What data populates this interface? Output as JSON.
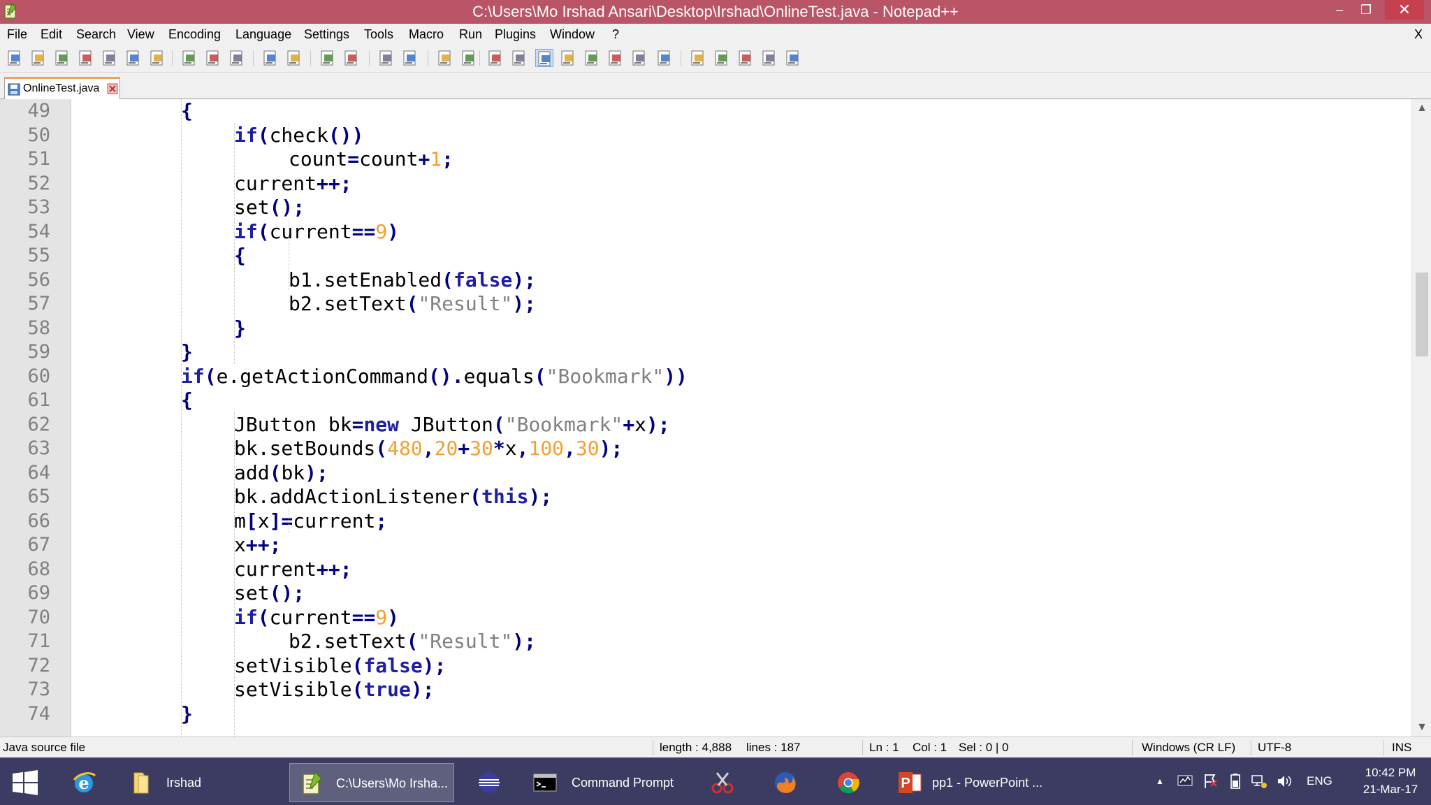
{
  "window": {
    "title": "C:\\Users\\Mo Irshad Ansari\\Desktop\\Irshad\\OnlineTest.java - Notepad++",
    "minimize": "–",
    "restore": "❐",
    "close": "✕"
  },
  "menu": {
    "items": [
      "File",
      "Edit",
      "Search",
      "View",
      "Encoding",
      "Language",
      "Settings",
      "Tools",
      "Macro",
      "Run",
      "Plugins",
      "Window",
      "?"
    ],
    "close": "X"
  },
  "toolbar": {
    "buttons": [
      "new-file-icon",
      "open-file-icon",
      "save-icon",
      "save-all-icon",
      "close-icon",
      "close-all-icon",
      "print-icon",
      "cut-icon",
      "copy-icon",
      "paste-icon",
      "undo-icon",
      "redo-icon",
      "find-icon",
      "replace-icon",
      "zoom-in-icon",
      "zoom-out-icon",
      "sync-vertical-icon",
      "sync-horizontal-icon",
      "word-wrap-icon",
      "show-all-chars-icon",
      "indent-guide-icon",
      "user-lang-icon",
      "doc-map-icon",
      "function-list-icon",
      "folder-workspace-icon",
      "monitoring-icon",
      "record-macro-icon",
      "stop-macro-icon",
      "play-macro-icon",
      "play-multiple-icon",
      "save-macro-icon"
    ]
  },
  "tab": {
    "label": "OnlineTest.java"
  },
  "editor": {
    "lines": [
      {
        "num": "49",
        "indent": 1,
        "tokens": [
          {
            "t": "{",
            "k": "punct"
          }
        ]
      },
      {
        "num": "50",
        "indent": 2,
        "tokens": [
          {
            "t": "if",
            "k": "kw"
          },
          {
            "t": "(",
            "k": "punct"
          },
          {
            "t": "check",
            "k": "id"
          },
          {
            "t": "())",
            "k": "punct"
          }
        ]
      },
      {
        "num": "51",
        "indent": 3,
        "tokens": [
          {
            "t": "count",
            "k": "id"
          },
          {
            "t": "=",
            "k": "op"
          },
          {
            "t": "count",
            "k": "id"
          },
          {
            "t": "+",
            "k": "op"
          },
          {
            "t": "1",
            "k": "num"
          },
          {
            "t": ";",
            "k": "punct"
          }
        ]
      },
      {
        "num": "52",
        "indent": 2,
        "tokens": [
          {
            "t": "current",
            "k": "id"
          },
          {
            "t": "++;",
            "k": "op"
          }
        ]
      },
      {
        "num": "53",
        "indent": 2,
        "tokens": [
          {
            "t": "set",
            "k": "id"
          },
          {
            "t": "();",
            "k": "punct"
          }
        ]
      },
      {
        "num": "54",
        "indent": 2,
        "tokens": [
          {
            "t": "if",
            "k": "kw"
          },
          {
            "t": "(",
            "k": "punct"
          },
          {
            "t": "current",
            "k": "id"
          },
          {
            "t": "==",
            "k": "op"
          },
          {
            "t": "9",
            "k": "num"
          },
          {
            "t": ")",
            "k": "punct"
          }
        ]
      },
      {
        "num": "55",
        "indent": 2,
        "tokens": [
          {
            "t": "{",
            "k": "punct"
          }
        ]
      },
      {
        "num": "56",
        "indent": 3,
        "tokens": [
          {
            "t": "b1.setEnabled",
            "k": "id"
          },
          {
            "t": "(",
            "k": "punct"
          },
          {
            "t": "false",
            "k": "kw"
          },
          {
            "t": ");",
            "k": "punct"
          }
        ]
      },
      {
        "num": "57",
        "indent": 3,
        "tokens": [
          {
            "t": "b2.setText",
            "k": "id"
          },
          {
            "t": "(",
            "k": "punct"
          },
          {
            "t": "\"Result\"",
            "k": "str"
          },
          {
            "t": ");",
            "k": "punct"
          }
        ]
      },
      {
        "num": "58",
        "indent": 2,
        "tokens": [
          {
            "t": "}",
            "k": "punct"
          }
        ]
      },
      {
        "num": "59",
        "indent": 1,
        "tokens": [
          {
            "t": "}",
            "k": "punct"
          }
        ]
      },
      {
        "num": "60",
        "indent": 1,
        "tokens": [
          {
            "t": "if",
            "k": "kw"
          },
          {
            "t": "(",
            "k": "punct"
          },
          {
            "t": "e.getActionCommand",
            "k": "id"
          },
          {
            "t": "().",
            "k": "punct"
          },
          {
            "t": "equals",
            "k": "id"
          },
          {
            "t": "(",
            "k": "punct"
          },
          {
            "t": "\"Bookmark\"",
            "k": "str"
          },
          {
            "t": "))",
            "k": "punct"
          }
        ]
      },
      {
        "num": "61",
        "indent": 1,
        "tokens": [
          {
            "t": "{",
            "k": "punct"
          }
        ]
      },
      {
        "num": "62",
        "indent": 2,
        "tokens": [
          {
            "t": "JButton bk",
            "k": "id"
          },
          {
            "t": "=",
            "k": "op"
          },
          {
            "t": "new",
            "k": "kw"
          },
          {
            "t": " JButton",
            "k": "id"
          },
          {
            "t": "(",
            "k": "punct"
          },
          {
            "t": "\"Bookmark\"",
            "k": "str"
          },
          {
            "t": "+",
            "k": "op"
          },
          {
            "t": "x",
            "k": "id"
          },
          {
            "t": ");",
            "k": "punct"
          }
        ]
      },
      {
        "num": "63",
        "indent": 2,
        "tokens": [
          {
            "t": "bk.setBounds",
            "k": "id"
          },
          {
            "t": "(",
            "k": "punct"
          },
          {
            "t": "480",
            "k": "num"
          },
          {
            "t": ",",
            "k": "punct"
          },
          {
            "t": "20",
            "k": "num"
          },
          {
            "t": "+",
            "k": "op"
          },
          {
            "t": "30",
            "k": "num"
          },
          {
            "t": "*",
            "k": "op"
          },
          {
            "t": "x",
            "k": "id"
          },
          {
            "t": ",",
            "k": "punct"
          },
          {
            "t": "100",
            "k": "num"
          },
          {
            "t": ",",
            "k": "punct"
          },
          {
            "t": "30",
            "k": "num"
          },
          {
            "t": ");",
            "k": "punct"
          }
        ]
      },
      {
        "num": "64",
        "indent": 2,
        "tokens": [
          {
            "t": "add",
            "k": "id"
          },
          {
            "t": "(",
            "k": "punct"
          },
          {
            "t": "bk",
            "k": "id"
          },
          {
            "t": ");",
            "k": "punct"
          }
        ]
      },
      {
        "num": "65",
        "indent": 2,
        "tokens": [
          {
            "t": "bk.addActionListener",
            "k": "id"
          },
          {
            "t": "(",
            "k": "punct"
          },
          {
            "t": "this",
            "k": "kw"
          },
          {
            "t": ");",
            "k": "punct"
          }
        ]
      },
      {
        "num": "66",
        "indent": 2,
        "tokens": [
          {
            "t": "m",
            "k": "id"
          },
          {
            "t": "[",
            "k": "punct"
          },
          {
            "t": "x",
            "k": "id"
          },
          {
            "t": "]=",
            "k": "op"
          },
          {
            "t": "current",
            "k": "id"
          },
          {
            "t": ";",
            "k": "punct"
          }
        ]
      },
      {
        "num": "67",
        "indent": 2,
        "tokens": [
          {
            "t": "x",
            "k": "id"
          },
          {
            "t": "++;",
            "k": "op"
          }
        ]
      },
      {
        "num": "68",
        "indent": 2,
        "tokens": [
          {
            "t": "current",
            "k": "id"
          },
          {
            "t": "++;",
            "k": "op"
          }
        ]
      },
      {
        "num": "69",
        "indent": 2,
        "tokens": [
          {
            "t": "set",
            "k": "id"
          },
          {
            "t": "();",
            "k": "punct"
          }
        ]
      },
      {
        "num": "70",
        "indent": 2,
        "tokens": [
          {
            "t": "if",
            "k": "kw"
          },
          {
            "t": "(",
            "k": "punct"
          },
          {
            "t": "current",
            "k": "id"
          },
          {
            "t": "==",
            "k": "op"
          },
          {
            "t": "9",
            "k": "num"
          },
          {
            "t": ")",
            "k": "punct"
          }
        ]
      },
      {
        "num": "71",
        "indent": 3,
        "tokens": [
          {
            "t": "b2.setText",
            "k": "id"
          },
          {
            "t": "(",
            "k": "punct"
          },
          {
            "t": "\"Result\"",
            "k": "str"
          },
          {
            "t": ");",
            "k": "punct"
          }
        ]
      },
      {
        "num": "72",
        "indent": 2,
        "tokens": [
          {
            "t": "setVisible",
            "k": "id"
          },
          {
            "t": "(",
            "k": "punct"
          },
          {
            "t": "false",
            "k": "kw"
          },
          {
            "t": ");",
            "k": "punct"
          }
        ]
      },
      {
        "num": "73",
        "indent": 2,
        "tokens": [
          {
            "t": "setVisible",
            "k": "id"
          },
          {
            "t": "(",
            "k": "punct"
          },
          {
            "t": "true",
            "k": "kw"
          },
          {
            "t": ");",
            "k": "punct"
          }
        ]
      },
      {
        "num": "74",
        "indent": 1,
        "tokens": [
          {
            "t": "}",
            "k": "punct"
          }
        ]
      }
    ]
  },
  "statusbar": {
    "file_type": "Java source file",
    "length": "length : 4,888",
    "lines": "lines : 187",
    "ln": "Ln : 1",
    "col": "Col : 1",
    "sel": "Sel : 0 | 0",
    "eol": "Windows (CR LF)",
    "encoding": "UTF-8",
    "mode": "INS"
  },
  "taskbar": {
    "apps": [
      {
        "label": "",
        "icon": "internet-explorer-icon",
        "active": false
      },
      {
        "label": "Irshad",
        "icon": "folder-icon",
        "active": false
      },
      {
        "label": "C:\\Users\\Mo Irsha...",
        "icon": "notepad-plus-plus-icon",
        "active": true
      },
      {
        "label": "",
        "icon": "eclipse-icon",
        "active": false
      },
      {
        "label": "Command Prompt",
        "icon": "command-prompt-icon",
        "active": false
      },
      {
        "label": "",
        "icon": "snipping-tool-icon",
        "active": false
      },
      {
        "label": "",
        "icon": "firefox-icon",
        "active": false
      },
      {
        "label": "",
        "icon": "chrome-icon",
        "active": false
      },
      {
        "label": "pp1 - PowerPoint ...",
        "icon": "powerpoint-icon",
        "active": false
      }
    ],
    "language": "ENG",
    "time": "10:42 PM",
    "date": "21-Mar-17"
  },
  "colors": {
    "titlebar": "#b95567",
    "taskbar": "#3c3c62",
    "keyword": "#1d1da8",
    "number": "#f0a030",
    "string": "#808080"
  }
}
